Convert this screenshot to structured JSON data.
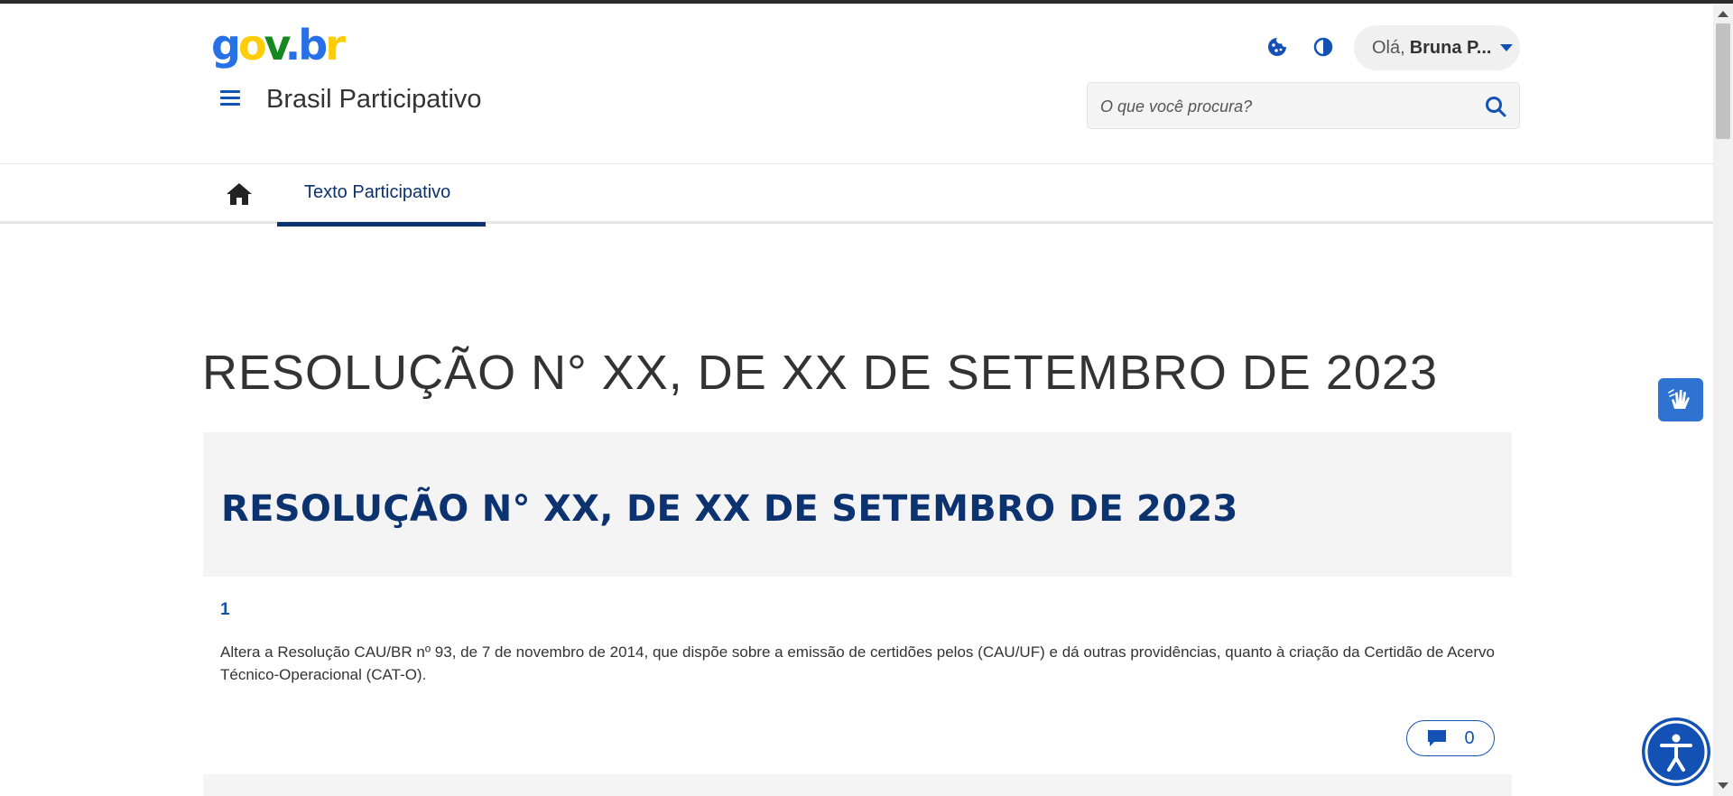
{
  "header": {
    "logo_parts": [
      "g",
      "o",
      "v",
      ".",
      "b",
      "r"
    ],
    "site_title": "Brasil Participativo",
    "user": {
      "greeting": "Olá,",
      "name": "Bruna P..."
    },
    "search": {
      "placeholder": "O que você procura?"
    }
  },
  "nav": {
    "tabs": [
      {
        "label": "Texto Participativo",
        "active": true
      }
    ]
  },
  "main": {
    "title": "RESOLUÇÃO N° XX, DE XX DE SETEMBRO DE 2023",
    "card_title": "RESOLUÇÃO N° XX, DE XX DE SETEMBRO DE 2023",
    "article": {
      "number": "1",
      "text": "Altera a Resolução CAU/BR nº 93, de 7 de novembro de 2014, que dispõe sobre a emissão de certidões pelos (CAU/UF) e dá outras providências, quanto à criação da Certidão de Acervo Técnico-Operacional (CAT-O).",
      "comment_count": "0"
    }
  },
  "colors": {
    "primary": "#1351b4",
    "dark_blue": "#0c326f",
    "gov_blue": "#2670e8",
    "gov_yellow": "#ffcd07",
    "gov_green": "#168821"
  },
  "icons": [
    "cookie-icon",
    "contrast-icon",
    "caret-down-icon",
    "search-icon",
    "menu-icon",
    "home-icon",
    "comment-icon",
    "sign-language-icon",
    "accessibility-icon"
  ]
}
